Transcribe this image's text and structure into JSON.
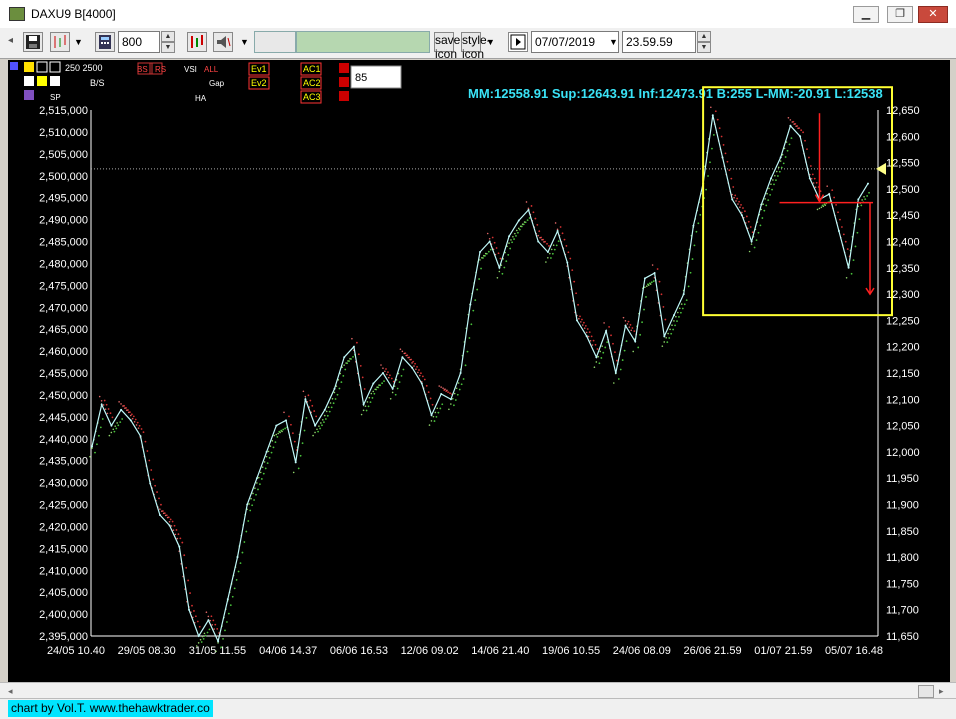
{
  "window": {
    "title": "DAXU9 B[4000]"
  },
  "toolbar": {
    "bars_value": "800",
    "date_value": "07/07/2019",
    "time_value": "23.59.59",
    "save_icon": "save-icon",
    "style_icon": "style-icon"
  },
  "indicator_panel": {
    "numbers": "250 2500",
    "buttons": [
      "BS",
      "RS",
      "VSI",
      "ALL",
      "Ev1",
      "Ev2",
      "AC1",
      "AC2",
      "AC3",
      "B/S",
      "Gap",
      "HA",
      "SP"
    ],
    "input_value": "85"
  },
  "info_line": "MM:12558.91 Sup:12643.91 Inf:12473.91 B:255 L-MM:-20.91 L:12538",
  "credit": "chart by Vol.T. www.thehawktrader.co",
  "colors": {
    "background": "#000000",
    "price_line": "#bff8f8",
    "info_text": "#3ae3f6",
    "highlight_box": "#ffff33",
    "arrows": "#ff2020",
    "green_dots": "#49c23c",
    "red_dots": "#d43030"
  },
  "chart_data": {
    "type": "line",
    "x_tick_labels": [
      "24/05 10.40",
      "29/05 08.30",
      "31/05 11.55",
      "04/06 14.37",
      "06/06 16.53",
      "12/06 09.02",
      "14/06 21.40",
      "19/06 10.55",
      "24/06 08.09",
      "26/06 21.59",
      "01/07 21.59",
      "05/07 16.48"
    ],
    "left_axis": {
      "min": 2395000,
      "max": 2515000,
      "step": 5000,
      "tick_labels": [
        "2,395,000",
        "2,400,000",
        "2,405,000",
        "2,410,000",
        "2,415,000",
        "2,420,000",
        "2,425,000",
        "2,430,000",
        "2,435,000",
        "2,440,000",
        "2,445,000",
        "2,450,000",
        "2,455,000",
        "2,460,000",
        "2,465,000",
        "2,470,000",
        "2,475,000",
        "2,480,000",
        "2,485,000",
        "2,490,000",
        "2,495,000",
        "2,500,000",
        "2,505,000",
        "2,510,000",
        "2,515,000"
      ]
    },
    "right_axis": {
      "min": 11650,
      "max": 12650,
      "step": 50,
      "tick_labels": [
        "11,650",
        "11,700",
        "11,750",
        "11,800",
        "11,850",
        "11,900",
        "11,950",
        "12,000",
        "12,050",
        "12,100",
        "12,150",
        "12,200",
        "12,250",
        "12,300",
        "12,350",
        "12,400",
        "12,450",
        "12,500",
        "12,550",
        "12,600",
        "12,650"
      ]
    },
    "series": [
      {
        "values": [
          12010,
          12090,
          12050,
          12080,
          12060,
          12030,
          11940,
          11880,
          11860,
          11820,
          11700,
          11650,
          11680,
          11640,
          11720,
          11800,
          11900,
          11950,
          12000,
          12050,
          12060,
          11980,
          12100,
          12050,
          12080,
          12120,
          12180,
          12200,
          12090,
          12130,
          12150,
          12120,
          12180,
          12160,
          12130,
          12070,
          12110,
          12100,
          12150,
          12280,
          12380,
          12400,
          12350,
          12410,
          12440,
          12460,
          12400,
          12380,
          12420,
          12360,
          12250,
          12220,
          12180,
          12230,
          12150,
          12240,
          12210,
          12330,
          12340,
          12220,
          12260,
          12300,
          12430,
          12510,
          12640,
          12560,
          12480,
          12450,
          12400,
          12470,
          12520,
          12560,
          12620,
          12600,
          12520,
          12480,
          12490,
          12420,
          12350,
          12480,
          12510
        ]
      }
    ],
    "reference_lines": {
      "support": 12643.91,
      "mm": 12558.91,
      "inferior": 12473.91,
      "last": 12538
    },
    "grid": false,
    "highlight_box": {
      "x_range_labels": [
        "01/07 21.59",
        "05/07 16.48"
      ]
    }
  }
}
